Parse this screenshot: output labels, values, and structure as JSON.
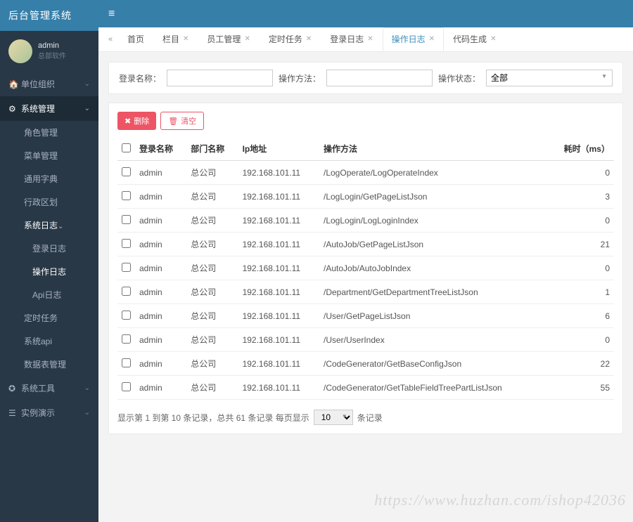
{
  "brand": "后台管理系统",
  "user": {
    "name": "admin",
    "role": "总部软件"
  },
  "sidebar": {
    "items": [
      {
        "icon": "🏠",
        "label": "单位组织",
        "expandable": true,
        "active": false
      },
      {
        "icon": "⚙",
        "label": "系统管理",
        "expandable": true,
        "active": true,
        "children": [
          {
            "label": "角色管理"
          },
          {
            "label": "菜单管理"
          },
          {
            "label": "通用字典"
          },
          {
            "label": "行政区划"
          },
          {
            "label": "系统日志",
            "expandable": true,
            "active": true,
            "children": [
              {
                "label": "登录日志"
              },
              {
                "label": "操作日志",
                "active": true
              },
              {
                "label": "Api日志"
              }
            ]
          },
          {
            "label": "定时任务"
          },
          {
            "label": "系统api"
          },
          {
            "label": "数据表管理"
          }
        ]
      },
      {
        "icon": "✪",
        "label": "系统工具",
        "expandable": true,
        "active": false
      },
      {
        "icon": "☰",
        "label": "实例演示",
        "expandable": true,
        "active": false
      }
    ]
  },
  "tabs": [
    {
      "label": "首页",
      "closable": false
    },
    {
      "label": "栏目",
      "closable": true
    },
    {
      "label": "员工管理",
      "closable": true
    },
    {
      "label": "定时任务",
      "closable": true
    },
    {
      "label": "登录日志",
      "closable": true
    },
    {
      "label": "操作日志",
      "closable": true,
      "active": true
    },
    {
      "label": "代码生成",
      "closable": true
    }
  ],
  "filter": {
    "loginLabel": "登录名称：",
    "methodLabel": "操作方法：",
    "statusLabel": "操作状态：",
    "statusValue": "全部"
  },
  "actions": {
    "delete": "删除",
    "clear": "清空"
  },
  "table": {
    "headers": [
      "登录名称",
      "部门名称",
      "Ip地址",
      "操作方法",
      "耗时（ms）"
    ],
    "rows": [
      {
        "login": "admin",
        "dept": "总公司",
        "ip": "192.168.101.11",
        "method": "/LogOperate/LogOperateIndex",
        "time": "0"
      },
      {
        "login": "admin",
        "dept": "总公司",
        "ip": "192.168.101.11",
        "method": "/LogLogin/GetPageListJson",
        "time": "3"
      },
      {
        "login": "admin",
        "dept": "总公司",
        "ip": "192.168.101.11",
        "method": "/LogLogin/LogLoginIndex",
        "time": "0"
      },
      {
        "login": "admin",
        "dept": "总公司",
        "ip": "192.168.101.11",
        "method": "/AutoJob/GetPageListJson",
        "time": "21"
      },
      {
        "login": "admin",
        "dept": "总公司",
        "ip": "192.168.101.11",
        "method": "/AutoJob/AutoJobIndex",
        "time": "0"
      },
      {
        "login": "admin",
        "dept": "总公司",
        "ip": "192.168.101.11",
        "method": "/Department/GetDepartmentTreeListJson",
        "time": "1"
      },
      {
        "login": "admin",
        "dept": "总公司",
        "ip": "192.168.101.11",
        "method": "/User/GetPageListJson",
        "time": "6"
      },
      {
        "login": "admin",
        "dept": "总公司",
        "ip": "192.168.101.11",
        "method": "/User/UserIndex",
        "time": "0"
      },
      {
        "login": "admin",
        "dept": "总公司",
        "ip": "192.168.101.11",
        "method": "/CodeGenerator/GetBaseConfigJson",
        "time": "22"
      },
      {
        "login": "admin",
        "dept": "总公司",
        "ip": "192.168.101.11",
        "method": "/CodeGenerator/GetTableFieldTreePartListJson",
        "time": "55"
      }
    ]
  },
  "pager": {
    "prefix": "显示第 1 到第 10 条记录，总共 61 条记录  每页显示",
    "pageSize": "10",
    "suffix": "条记录"
  },
  "watermark": "https://www.huzhan.com/ishop42036"
}
